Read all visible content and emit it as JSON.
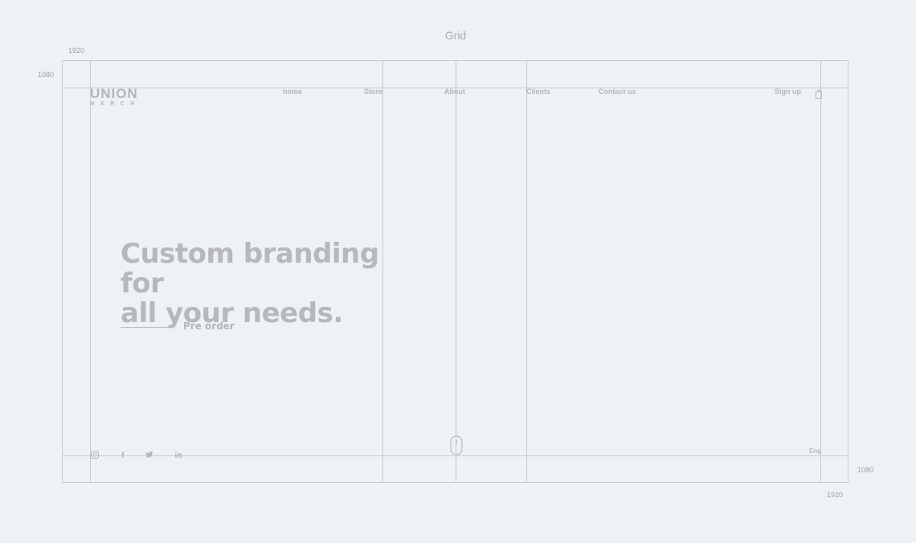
{
  "page": {
    "title": "Grid"
  },
  "dimensions": {
    "top_width": "1920",
    "left_height": "1080",
    "right_height": "1080",
    "bottom_width": "1920"
  },
  "logo": {
    "main": "UNION",
    "sub": "MERCH"
  },
  "nav": {
    "home": "home",
    "store": "Store",
    "about": "About",
    "clients": "Clients",
    "contact": "Contact us",
    "signup": "Sign up"
  },
  "hero": {
    "line1": "Custom branding for",
    "line2": "all your needs.",
    "cta": "Pre order"
  },
  "footer": {
    "lang": "Eng"
  },
  "icons": {
    "bag": "shopping-bag-icon",
    "instagram": "instagram-icon",
    "facebook": "facebook-icon",
    "twitter": "twitter-icon",
    "linkedin": "linkedin-icon",
    "scroll": "mouse-scroll-icon"
  },
  "colors": {
    "background": "#eef1f5",
    "guide": "#c7cbd0",
    "text": "#b3b6ba"
  }
}
